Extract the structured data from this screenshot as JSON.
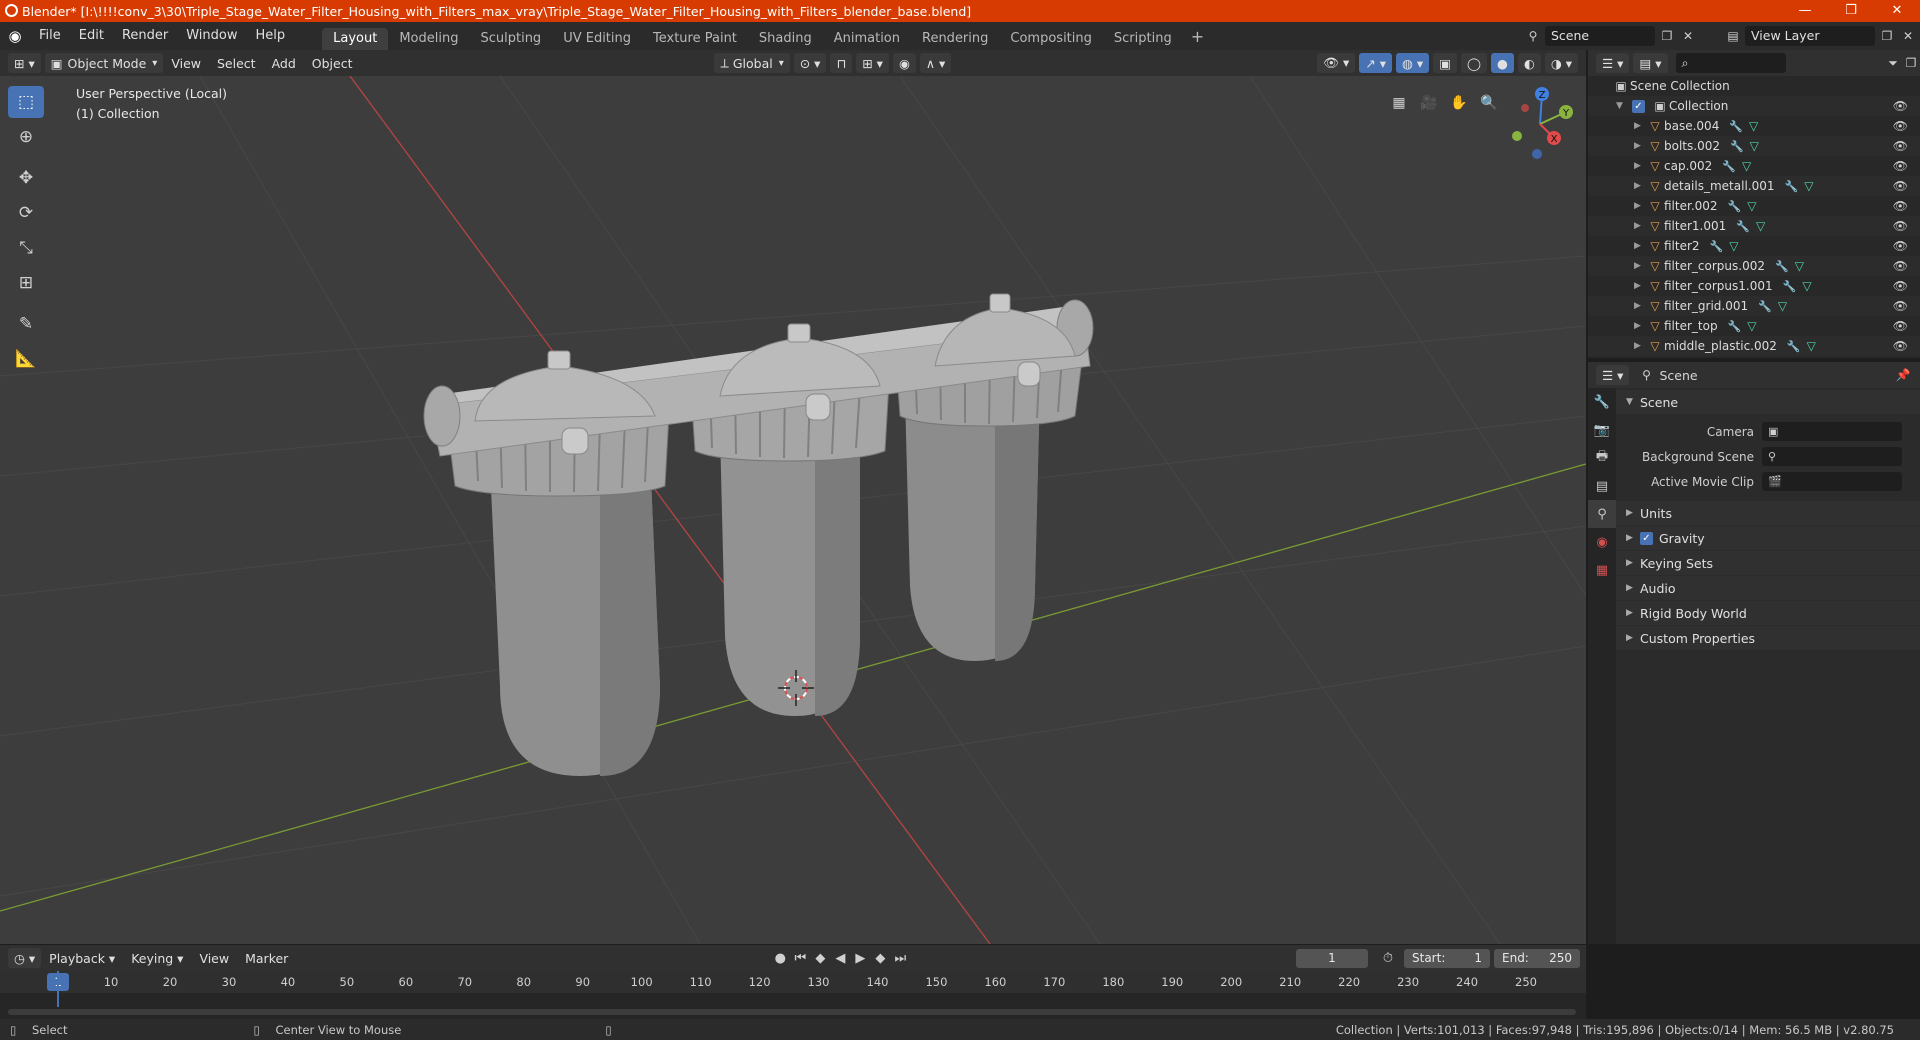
{
  "window": {
    "title": "Blender* [I:\\!!!!conv_3\\30\\Triple_Stage_Water_Filter_Housing_with_Filters_max_vray\\Triple_Stage_Water_Filter_Housing_with_Filters_blender_base.blend]",
    "minimize": "—",
    "maximize": "❐",
    "close": "✕"
  },
  "menubar": {
    "items": [
      "File",
      "Edit",
      "Render",
      "Window",
      "Help"
    ],
    "workspaces": [
      "Layout",
      "Modeling",
      "Sculpting",
      "UV Editing",
      "Texture Paint",
      "Shading",
      "Animation",
      "Rendering",
      "Compositing",
      "Scripting"
    ],
    "active_workspace": "Layout",
    "scene": "Scene",
    "view_layer": "View Layer"
  },
  "viewport_header": {
    "mode": "Object Mode",
    "menus": [
      "View",
      "Select",
      "Add",
      "Object"
    ],
    "orientation": "Global"
  },
  "viewport": {
    "perspective": "User Perspective (Local)",
    "collection": "(1) Collection",
    "axis_labels": {
      "x": "X",
      "y": "Y",
      "z": "Z"
    }
  },
  "outliner": {
    "root": "Scene Collection",
    "collection": "Collection",
    "items": [
      "base.004",
      "bolts.002",
      "cap.002",
      "details_metall.001",
      "filter.002",
      "filter1.001",
      "filter2",
      "filter_corpus.002",
      "filter_corpus1.001",
      "filter_grid.001",
      "filter_top",
      "middle_plastic.002"
    ]
  },
  "properties": {
    "header_title": "Scene",
    "section": "Scene",
    "fields": [
      {
        "label": "Camera",
        "value": ""
      },
      {
        "label": "Background Scene",
        "value": ""
      },
      {
        "label": "Active Movie Clip",
        "value": ""
      }
    ],
    "subsections": [
      "Units",
      "Gravity",
      "Keying Sets",
      "Audio",
      "Rigid Body World",
      "Custom Properties"
    ]
  },
  "timeline": {
    "menus": [
      "Playback",
      "Keying",
      "View",
      "Marker"
    ],
    "current_frame": "1",
    "start_label": "Start:",
    "start": "1",
    "end_label": "End:",
    "end": "250",
    "ticks": [
      "1",
      "10",
      "20",
      "30",
      "40",
      "50",
      "60",
      "70",
      "80",
      "90",
      "100",
      "110",
      "120",
      "130",
      "140",
      "150",
      "160",
      "170",
      "180",
      "190",
      "200",
      "210",
      "220",
      "230",
      "240",
      "250"
    ]
  },
  "statusbar": {
    "left_action": "Select",
    "middle_action": "Center View to Mouse",
    "stats": "Collection | Verts:101,013 | Faces:97,948 | Tris:195,896 | Objects:0/14 | Mem: 56.5 MB | v2.80.75"
  },
  "colors": {
    "accent": "#4772b3",
    "title_bar": "#d83b01",
    "x_axis": "#e04a4a",
    "y_axis": "#8ab440",
    "z_axis": "#3f80e0"
  }
}
